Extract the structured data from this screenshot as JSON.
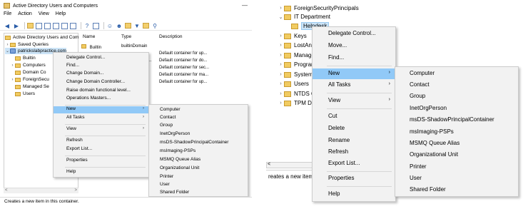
{
  "left": {
    "window_title": "Active Directory Users and Computers",
    "menubar": [
      "File",
      "Action",
      "View",
      "Help"
    ],
    "tree": [
      {
        "label": "Active Directory Users and Com",
        "type": "root"
      },
      {
        "label": "Saved Queries",
        "type": "folder"
      },
      {
        "label": "patrickslabpractice.com",
        "type": "domain"
      },
      {
        "label": "Builtin",
        "type": "folder"
      },
      {
        "label": "Computers",
        "type": "folder"
      },
      {
        "label": "Domain Co",
        "type": "folder"
      },
      {
        "label": "ForeignSecu",
        "type": "folder"
      },
      {
        "label": "Managed Se",
        "type": "folder"
      },
      {
        "label": "Users",
        "type": "folder"
      }
    ],
    "columns": [
      "Name",
      "Type",
      "Description"
    ],
    "rows": [
      {
        "name": "Builtin",
        "type": "builtinDomain",
        "description": ""
      },
      {
        "name": "",
        "type": "",
        "description": "Default container for up..."
      },
      {
        "name": "",
        "type": "l...",
        "description": "Default container for do..."
      },
      {
        "name": "",
        "type": "",
        "description": "Default container for sec..."
      },
      {
        "name": "",
        "type": "",
        "description": "Default container for ma..."
      },
      {
        "name": "",
        "type": "",
        "description": "Default container for up..."
      }
    ],
    "context_menu": [
      {
        "label": "Delegate Control..."
      },
      {
        "label": "Find..."
      },
      {
        "label": "Change Domain..."
      },
      {
        "label": "Change Domain Controller..."
      },
      {
        "label": "Raise domain functional level..."
      },
      {
        "label": "Operations Masters..."
      },
      {
        "label": "New",
        "submenu": true,
        "highlighted": true
      },
      {
        "label": "All Tasks",
        "submenu": true
      },
      {
        "label": "View",
        "submenu": true
      },
      {
        "label": "Refresh"
      },
      {
        "label": "Export List..."
      },
      {
        "label": "Properties"
      },
      {
        "label": "Help"
      }
    ],
    "new_submenu": [
      "Computer",
      "Contact",
      "Group",
      "InetOrgPerson",
      "msDS-ShadowPrincipalContainer",
      "msImaging-PSPs",
      "MSMQ Queue Alias",
      "Organizational Unit",
      "Printer",
      "User",
      "Shared Folder"
    ],
    "status_text": "Creates a new item in this container."
  },
  "right": {
    "tree": [
      {
        "label": "ForeignSecurityPrincipals",
        "caret": "›"
      },
      {
        "label": "IT Department",
        "caret": "⌄"
      },
      {
        "label": "Helpdesk",
        "caret": "",
        "selected": true
      },
      {
        "label": "Keys",
        "caret": "›"
      },
      {
        "label": "LostAnd",
        "caret": "›"
      },
      {
        "label": "Manage",
        "caret": "›"
      },
      {
        "label": "Progran",
        "caret": "›"
      },
      {
        "label": "System",
        "caret": "›"
      },
      {
        "label": "Users",
        "caret": "›"
      },
      {
        "label": "NTDS Q",
        "caret": "›"
      },
      {
        "label": "TPM De",
        "caret": "›"
      }
    ],
    "context_menu": [
      {
        "label": "Delegate Control..."
      },
      {
        "label": "Move..."
      },
      {
        "label": "Find..."
      },
      {
        "label": "New",
        "submenu": true,
        "highlighted": true
      },
      {
        "label": "All Tasks",
        "submenu": true
      },
      {
        "label": "View",
        "submenu": true
      },
      {
        "label": "Cut"
      },
      {
        "label": "Delete"
      },
      {
        "label": "Rename"
      },
      {
        "label": "Refresh"
      },
      {
        "label": "Export List..."
      },
      {
        "label": "Properties"
      },
      {
        "label": "Help"
      }
    ],
    "new_submenu": [
      "Computer",
      "Contact",
      "Group",
      "InetOrgPerson",
      "msDS-ShadowPrincipalContainer",
      "msImaging-PSPs",
      "MSMQ Queue Alias",
      "Organizational Unit",
      "Printer",
      "User",
      "Shared Folder"
    ],
    "status_text": "reates a new item"
  },
  "colors": {
    "highlight": "#91c9f7",
    "selection": "#cce4f7",
    "folder": "#f1cb61",
    "menu_bg": "#f2f2f2"
  }
}
